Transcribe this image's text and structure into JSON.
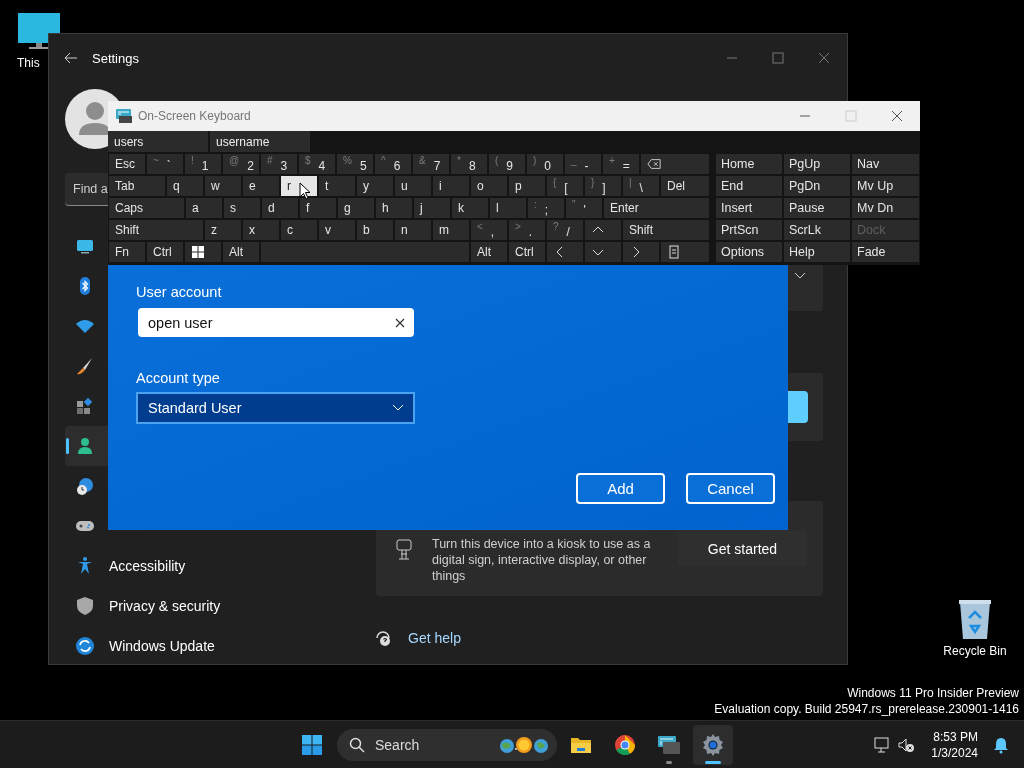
{
  "desktop": {
    "icons": [
      {
        "kind": "monitor",
        "label": "This"
      },
      {
        "kind": "recycle_bin",
        "label": "Recycle Bin"
      }
    ],
    "build_info": [
      "Windows 11 Pro Insider Preview",
      "Evaluation copy. Build 25947.rs_prerelease.230901-1416"
    ]
  },
  "settings": {
    "title": "Settings",
    "search": {
      "placeholder": "Find a"
    },
    "sidebar": [
      {
        "kind": "display",
        "selected": false
      },
      {
        "kind": "bluetooth",
        "selected": false
      },
      {
        "kind": "wifi",
        "selected": false
      },
      {
        "kind": "brush",
        "selected": false
      },
      {
        "kind": "apps",
        "selected": false
      },
      {
        "kind": "person",
        "selected": true
      },
      {
        "kind": "globe",
        "selected": false
      },
      {
        "kind": "gamepad",
        "selected": false
      },
      {
        "kind": "accessibility",
        "label": "Accessibility",
        "selected": false
      },
      {
        "kind": "shield",
        "label": "Privacy & security",
        "selected": false
      },
      {
        "kind": "update",
        "label": "Windows Update",
        "selected": false
      }
    ],
    "kiosk": {
      "text": "Turn this device into a kiosk to use as a digital sign, interactive display, or other things",
      "button": "Get started"
    },
    "help_link": "Get help"
  },
  "dialog": {
    "user_label": "User account",
    "user_value": "open user",
    "type_label": "Account type",
    "type_value": "Standard User",
    "buttons": [
      "Add",
      "Cancel"
    ]
  },
  "osk": {
    "title": "On-Screen Keyboard",
    "predictions": [
      "users",
      "username"
    ],
    "rows": [
      {
        "keys": [
          {
            "kind": "text",
            "label": "Esc",
            "hover": false
          },
          {
            "kind": "text",
            "shift": "~",
            "label": "`",
            "hover": false
          },
          {
            "kind": "text",
            "shift": "!",
            "label": "1",
            "hover": false
          },
          {
            "kind": "text",
            "shift": "@",
            "label": "2",
            "hover": false
          },
          {
            "kind": "text",
            "shift": "#",
            "label": "3",
            "hover": false
          },
          {
            "kind": "text",
            "shift": "$",
            "label": "4",
            "hover": false
          },
          {
            "kind": "text",
            "shift": "%",
            "label": "5",
            "hover": false
          },
          {
            "kind": "text",
            "shift": "^",
            "label": "6",
            "hover": false
          },
          {
            "kind": "text",
            "shift": "&",
            "label": "7",
            "hover": false
          },
          {
            "kind": "text",
            "shift": "*",
            "label": "8",
            "hover": false
          },
          {
            "kind": "text",
            "shift": "(",
            "label": "9",
            "hover": false
          },
          {
            "kind": "text",
            "shift": ")",
            "label": "0",
            "hover": false
          },
          {
            "kind": "text",
            "shift": "_",
            "label": "-",
            "hover": false
          },
          {
            "kind": "text",
            "shift": "+",
            "label": "=",
            "hover": false
          },
          {
            "kind": "backspace",
            "hover": false
          }
        ]
      },
      {
        "keys": [
          {
            "kind": "text",
            "label": "Tab",
            "hover": false
          },
          {
            "kind": "text",
            "label": "q",
            "hover": false
          },
          {
            "kind": "text",
            "label": "w",
            "hover": false
          },
          {
            "kind": "text",
            "label": "e",
            "hover": false
          },
          {
            "kind": "text",
            "label": "r",
            "hover": true
          },
          {
            "kind": "text",
            "label": "t",
            "hover": false
          },
          {
            "kind": "text",
            "label": "y",
            "hover": false
          },
          {
            "kind": "text",
            "label": "u",
            "hover": false
          },
          {
            "kind": "text",
            "label": "i",
            "hover": false
          },
          {
            "kind": "text",
            "label": "o",
            "hover": false
          },
          {
            "kind": "text",
            "label": "p",
            "hover": false
          },
          {
            "kind": "text",
            "shift": "{",
            "label": "[",
            "hover": false
          },
          {
            "kind": "text",
            "shift": "}",
            "label": "]",
            "hover": false
          },
          {
            "kind": "text",
            "shift": "|",
            "label": "\\",
            "hover": false
          },
          {
            "kind": "text",
            "label": "Del",
            "hover": false
          }
        ]
      },
      {
        "keys": [
          {
            "kind": "text",
            "label": "Caps",
            "hover": false
          },
          {
            "kind": "text",
            "label": "a",
            "hover": false
          },
          {
            "kind": "text",
            "label": "s",
            "hover": false
          },
          {
            "kind": "text",
            "label": "d",
            "hover": false
          },
          {
            "kind": "text",
            "label": "f",
            "hover": false
          },
          {
            "kind": "text",
            "label": "g",
            "hover": false
          },
          {
            "kind": "text",
            "label": "h",
            "hover": false
          },
          {
            "kind": "text",
            "label": "j",
            "hover": false
          },
          {
            "kind": "text",
            "label": "k",
            "hover": false
          },
          {
            "kind": "text",
            "label": "l",
            "hover": false
          },
          {
            "kind": "text",
            "shift": ":",
            "label": ";",
            "hover": false
          },
          {
            "kind": "text",
            "shift": "\"",
            "label": "'",
            "hover": false
          },
          {
            "kind": "text",
            "label": "Enter",
            "hover": false
          }
        ]
      },
      {
        "keys": [
          {
            "kind": "text",
            "label": "Shift",
            "hover": false
          },
          {
            "kind": "text",
            "label": "z",
            "hover": false
          },
          {
            "kind": "text",
            "label": "x",
            "hover": false
          },
          {
            "kind": "text",
            "label": "c",
            "hover": false
          },
          {
            "kind": "text",
            "label": "v",
            "hover": false
          },
          {
            "kind": "text",
            "label": "b",
            "hover": false
          },
          {
            "kind": "text",
            "label": "n",
            "hover": false
          },
          {
            "kind": "text",
            "label": "m",
            "hover": false
          },
          {
            "kind": "text",
            "shift": "<",
            "label": ",",
            "hover": false
          },
          {
            "kind": "text",
            "shift": ">",
            "label": ".",
            "hover": false
          },
          {
            "kind": "text",
            "shift": "?",
            "label": "/",
            "hover": false
          },
          {
            "kind": "up",
            "hover": false
          },
          {
            "kind": "text",
            "label": "Shift",
            "hover": false
          }
        ]
      },
      {
        "keys": [
          {
            "kind": "text",
            "label": "Fn",
            "hover": false
          },
          {
            "kind": "text",
            "label": "Ctrl",
            "hover": false
          },
          {
            "kind": "win",
            "hover": false
          },
          {
            "kind": "text",
            "label": "Alt",
            "hover": false
          },
          {
            "kind": "space",
            "hover": false
          },
          {
            "kind": "text",
            "label": "Alt",
            "hover": false
          },
          {
            "kind": "text",
            "label": "Ctrl",
            "hover": false
          },
          {
            "kind": "left",
            "hover": false
          },
          {
            "kind": "down",
            "hover": false
          },
          {
            "kind": "right",
            "hover": false
          },
          {
            "kind": "menu",
            "hover": false
          }
        ]
      }
    ],
    "side_keys": [
      {
        "label": "Home",
        "disabled": false
      },
      {
        "label": "PgUp",
        "disabled": false
      },
      {
        "label": "Nav",
        "disabled": false
      },
      {
        "label": "End",
        "disabled": false
      },
      {
        "label": "PgDn",
        "disabled": false
      },
      {
        "label": "Mv Up",
        "disabled": false
      },
      {
        "label": "Insert",
        "disabled": false
      },
      {
        "label": "Pause",
        "disabled": false
      },
      {
        "label": "Mv Dn",
        "disabled": false
      },
      {
        "label": "PrtScn",
        "disabled": false
      },
      {
        "label": "ScrLk",
        "disabled": false
      },
      {
        "label": "Dock",
        "disabled": true
      },
      {
        "label": "Options",
        "disabled": false
      },
      {
        "label": "Help",
        "disabled": false
      },
      {
        "label": "Fade",
        "disabled": false
      }
    ]
  },
  "taskbar": {
    "search": "Search",
    "apps": [
      {
        "kind": "folder",
        "running": false,
        "selected": false
      },
      {
        "kind": "browser",
        "running": false,
        "selected": false
      },
      {
        "kind": "keyboard",
        "running": true,
        "selected": false
      },
      {
        "kind": "gear",
        "running": true,
        "selected": true
      }
    ],
    "time": "8:53 PM",
    "date": "1/3/2024"
  }
}
